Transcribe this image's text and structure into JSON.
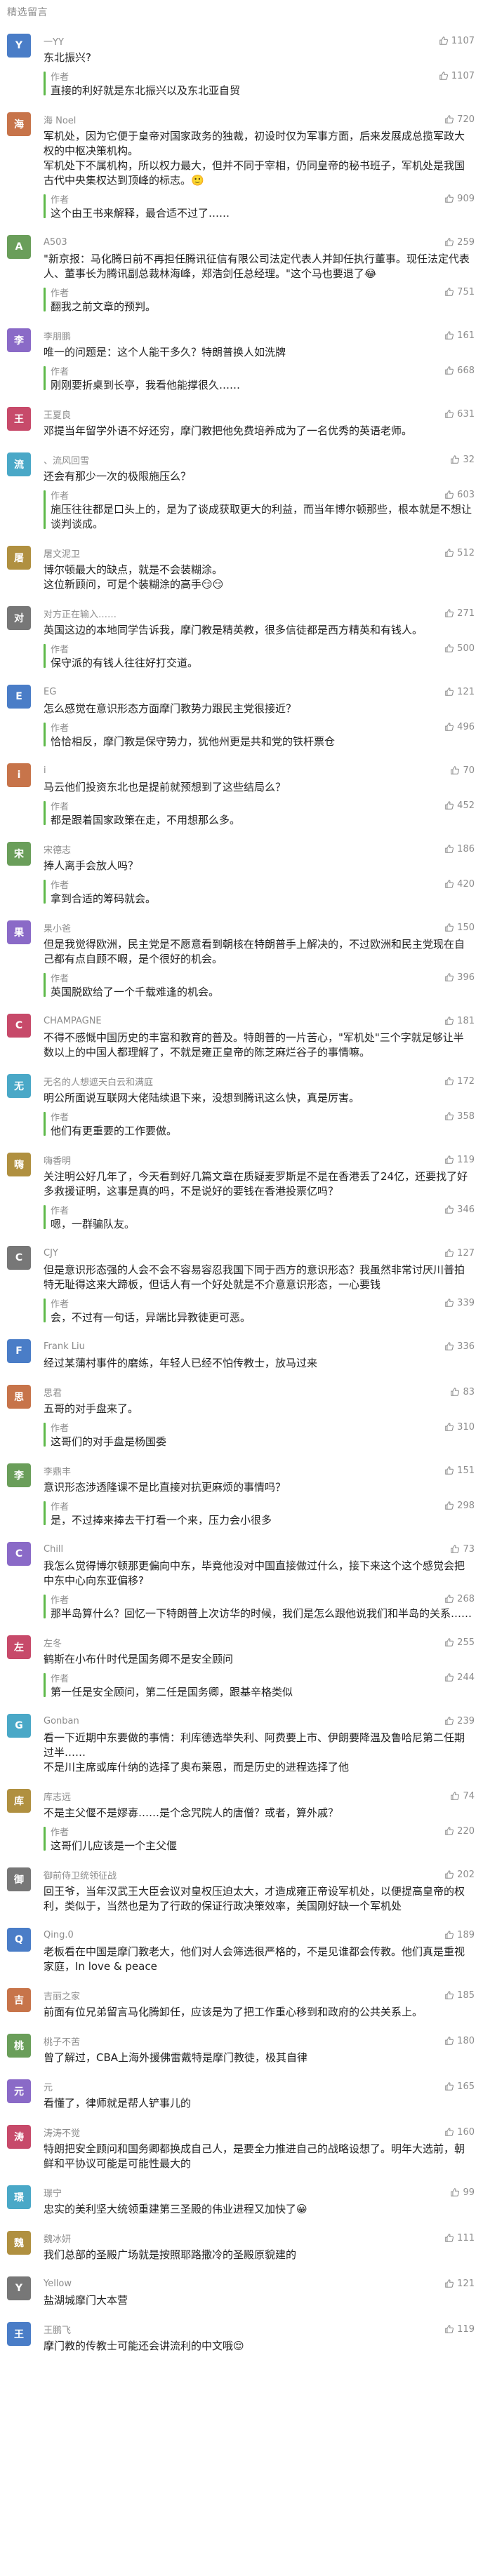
{
  "header": {
    "title": "精选留言"
  },
  "reply_author": "作者",
  "comments": [
    {
      "nick": "一YY",
      "avatar": "Y",
      "text": "东北振兴?",
      "likes": "1107",
      "reply": "直接的利好就是东北振兴以及东北亚自贸",
      "reply_likes": "1107"
    },
    {
      "nick": "海 Noel",
      "avatar": "海",
      "text": "军机处，因为它便于皇帝对国家政务的独裁，初设时仅为军事方面，后来发展成总揽军政大权的中枢决策机构。\n军机处下不属机构，所以权力最大，但并不同于宰相，仍同皇帝的秘书班子，军机处是我国古代中央集权达到顶峰的标志。🙂",
      "likes": "720",
      "reply": "这个由王书来解释，最合适不过了……",
      "reply_likes": "909"
    },
    {
      "nick": "A503",
      "avatar": "A",
      "text": "\"新京报：马化腾日前不再担任腾讯征信有限公司法定代表人并卸任执行董事。现任法定代表人、董事长为腾讯副总裁林海峰，郑浩剑任总经理。\"这个马也要退了😂",
      "likes": "259",
      "reply": "翻我之前文章的预判。",
      "reply_likes": "751"
    },
    {
      "nick": "李朋鹏",
      "avatar": "李",
      "text": "唯一的问题是：这个人能干多久？特朗普换人如洗牌",
      "likes": "161",
      "reply": "刚刚要折桌到长亭，我看他能撑很久……",
      "reply_likes": "668"
    },
    {
      "nick": "王夏良",
      "avatar": "王",
      "text": "邓提当年留学外语不好还穷，摩门教把他免费培养成为了一名优秀的英语老师。",
      "likes": "631",
      "reply": null
    },
    {
      "nick": "、流风回雪",
      "avatar": "流",
      "text": "还会有那少一次的极限施压么？",
      "likes": "32",
      "reply": "施压往往都是口头上的，是为了谈成获取更大的利益，而当年博尔顿那些，根本就是不想让谈判谈成。",
      "reply_likes": "603"
    },
    {
      "nick": "屠文泥卫",
      "avatar": "屠",
      "text": "博尔顿最大的缺点，就是不会装糊涂。\n这位新顾问，可是个装糊涂的高手😏😏",
      "likes": "512",
      "reply": null
    },
    {
      "nick": "对方正在输入……",
      "avatar": "对",
      "text": "英国这边的本地同学告诉我，摩门教是精英教，很多信徒都是西方精英和有钱人。",
      "likes": "271",
      "reply": "保守派的有钱人往往好打交道。",
      "reply_likes": "500"
    },
    {
      "nick": "EG",
      "avatar": "E",
      "text": "怎么感觉在意识形态方面摩门教势力跟民主党很接近？",
      "likes": "121",
      "reply": "恰恰相反，摩门教是保守势力，犹他州更是共和党的铁杆票仓",
      "reply_likes": "496"
    },
    {
      "nick": "i",
      "avatar": "i",
      "text": "马云他们投资东北也是提前就预想到了这些结局么？",
      "likes": "70",
      "reply": "都是跟着国家政策在走，不用想那么多。",
      "reply_likes": "452"
    },
    {
      "nick": "宋德志",
      "avatar": "宋",
      "text": "捧人离手会放人吗？",
      "likes": "186",
      "reply": "拿到合适的筹码就会。",
      "reply_likes": "420"
    },
    {
      "nick": "果小爸",
      "avatar": "果",
      "text": "但是我觉得欧洲，民主党是不愿意看到朝核在特朗普手上解决的，不过欧洲和民主党现在自己都有点自顾不暇，是个很好的机会。",
      "likes": "150",
      "reply": "英国脱欧给了一个千载难逢的机会。",
      "reply_likes": "396"
    },
    {
      "nick": "CHAMPAGNE",
      "avatar": "C",
      "text": "不得不感慨中国历史的丰富和教育的普及。特朗普的一片苦心，\"军机处\"三个字就足够让半数以上的中国人都理解了，不就是雍正皇帝的陈芝麻烂谷子的事情嘛。",
      "likes": "181",
      "reply": null
    },
    {
      "nick": "无名的人想遮天白云和满庭",
      "avatar": "无",
      "text": "明公所面说互联网大佬陆续退下来，没想到腾讯这么快，真是厉害。",
      "likes": "172",
      "reply": "他们有更重要的工作要做。",
      "reply_likes": "358"
    },
    {
      "nick": "嗨香明",
      "avatar": "嗨",
      "text": "关注明公好几年了，今天看到好几篇文章在质疑麦罗斯是不是在香港丢了24亿，还要找了好多救援证明，这事是真的吗，不是说好的要钱在香港投票亿吗？",
      "likes": "119",
      "reply": "嗯，一群骗队友。",
      "reply_likes": "346"
    },
    {
      "nick": "CJY",
      "avatar": "C",
      "text": "但是意识形态强的人会不会不容易容忍我国下同于西方的意识形态？我虽然非常讨厌川普拍特无耻得这来大蹄板，但话人有一个好处就是不介意意识形态，一心要钱",
      "likes": "127",
      "reply": "会，不过有一句话，异端比异教徒更可恶。",
      "reply_likes": "339"
    },
    {
      "nick": "Frank Liu",
      "avatar": "F",
      "text": "经过某蒲村事件的磨练，年轻人已经不怕传教士，放马过来",
      "likes": "336",
      "reply": null
    },
    {
      "nick": "思君",
      "avatar": "思",
      "text": "五哥的对手盘来了。",
      "likes": "83",
      "reply": "这哥们的对手盘是杨国委",
      "reply_likes": "310"
    },
    {
      "nick": "李鼎丰",
      "avatar": "李",
      "text": "意识形态涉透隆课不是比直接对抗更麻烦的事情吗？",
      "likes": "151",
      "reply": "是，不过捧来捧去干打看一个来，压力会小很多",
      "reply_likes": "298"
    },
    {
      "nick": "Chill",
      "avatar": "C",
      "text": "我怎么觉得博尔顿那更偏向中东，毕竟他没对中国直接做过什么，接下来这个这个感觉会把中东中心向东亚偏移?",
      "likes": "73",
      "reply": "那半岛算什么？回忆一下特朗普上次访华的时候，我们是怎么跟他说我们和半岛的关系……",
      "reply_likes": "268"
    },
    {
      "nick": "左冬",
      "avatar": "左",
      "text": "鹤斯在小布什时代是国务卿不是安全顾问",
      "likes": "255",
      "reply": "第一任是安全顾问，第二任是国务卿，跟基辛格类似",
      "reply_likes": "244"
    },
    {
      "nick": "Gonban",
      "avatar": "G",
      "text": "看一下近期中东要做的事情：利库德选举失利、阿费要上市、伊朗要降温及鲁哈尼第二任期过半……\n不是川主席或库什纳的选择了奥布莱恩，而是历史的进程选择了他",
      "likes": "239",
      "reply": null
    },
    {
      "nick": "库志远",
      "avatar": "库",
      "text": "不是主父偃不是嫪毐……是个念咒院人的唐僧？或者，算外戚？",
      "likes": "74",
      "reply": "这哥们儿应该是一个主父偃",
      "reply_likes": "220"
    },
    {
      "nick": "御前侍卫统领征战",
      "avatar": "御",
      "text": "回王爷，当年汉武王大臣会议对皇权压迫太大，才造成雍正帝设军机处，以便提高皇帝的权利，类似于，当然也是为了行政的保证行政决策效率，美国刚好缺一个军机处",
      "likes": "202",
      "reply": null
    },
    {
      "nick": "Qing.0",
      "avatar": "Q",
      "text": "老板看在中国是摩门教老大，他们对人会筛选很严格的，不是见谁都会传教。他们真是重视家庭，In love & peace",
      "likes": "189",
      "reply": null
    },
    {
      "nick": "吉丽之家",
      "avatar": "吉",
      "text": "前面有位兄弟留言马化腾卸任，应该是为了把工作重心移到和政府的公共关系上。",
      "likes": "185",
      "reply": null
    },
    {
      "nick": "桃子不苦",
      "avatar": "桃",
      "text": "曾了解过，CBA上海外援佛雷戴特是摩门教徒，极其自律",
      "likes": "180",
      "reply": null
    },
    {
      "nick": "元",
      "avatar": "元",
      "text": "看懂了，律师就是帮人铲事儿的",
      "likes": "165",
      "reply": null
    },
    {
      "nick": "涛涛不觉",
      "avatar": "涛",
      "text": "特朗把安全顾问和国务卿都换成自己人，是要全力推进自己的战略设想了。明年大选前，朝鲜和平协议可能是可能性最大的",
      "likes": "160",
      "reply": null
    },
    {
      "nick": "璟宁",
      "avatar": "璟",
      "text": "忠实的美利坚大统领重建第三圣殿的伟业进程又加快了😀",
      "likes": "99",
      "reply": null
    },
    {
      "nick": "魏冰妍",
      "avatar": "魏",
      "text": "我们总部的圣殿广场就是按照耶路撒冷的圣殿原貌建的",
      "likes": "111",
      "reply": null
    },
    {
      "nick": "Yellow",
      "avatar": "Y",
      "text": "盐湖城摩门大本营",
      "likes": "121",
      "reply": null
    },
    {
      "nick": "王鹏飞",
      "avatar": "王",
      "text": "摩门教的传教士可能还会讲流利的中文哦😌",
      "likes": "119",
      "reply": null
    }
  ]
}
